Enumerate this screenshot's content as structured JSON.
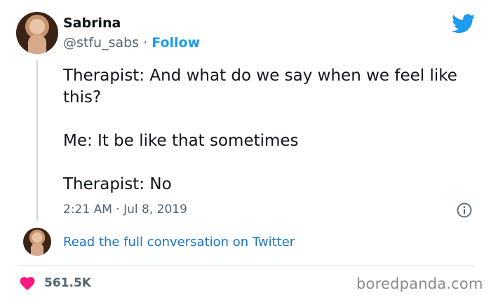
{
  "author": {
    "name": "Sabrina",
    "handle": "@stfu_sabs",
    "separator": "·",
    "follow_label": "Follow"
  },
  "tweet": {
    "paragraphs": [
      "Therapist: And what do we say when we feel like this?",
      "Me: It be like that sometimes",
      "Therapist: No"
    ],
    "timestamp": "2:21 AM · Jul 8, 2019"
  },
  "conversation_link": "Read the full conversation on Twitter",
  "likes": "561.5K",
  "watermark": "boredpanda.com",
  "colors": {
    "twitter_blue": "#1d9bf0",
    "heart": "#f91880",
    "muted": "#536471"
  },
  "icons": [
    "twitter-bird-icon",
    "info-icon",
    "heart-icon"
  ]
}
